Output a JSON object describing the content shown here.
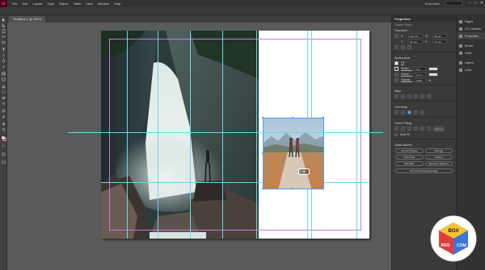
{
  "app": {
    "logo": "Id",
    "menu": [
      "File",
      "Edit",
      "Layout",
      "Type",
      "Object",
      "Table",
      "View",
      "Window",
      "Help"
    ],
    "workspace": "Essentials",
    "window_controls": [
      "–",
      "□",
      "✕"
    ]
  },
  "document": {
    "tab_label": "*Untitled-1 @ 104%"
  },
  "tools": [
    "selection-tool-icon",
    "direct-selection-tool-icon",
    "page-tool-icon",
    "gap-tool-icon",
    "content-collector-icon",
    "type-tool-icon",
    "line-tool-icon",
    "pen-tool-icon",
    "pencil-tool-icon",
    "rectangle-frame-tool-icon",
    "rectangle-tool-icon",
    "scissors-tool-icon",
    "free-transform-tool-icon",
    "gradient-swatch-tool-icon",
    "gradient-feather-tool-icon",
    "note-tool-icon",
    "eyedropper-tool-icon",
    "hand-tool-icon",
    "zoom-tool-icon",
    "fill-stroke-icon",
    "swap-icon",
    "default-colors-icon",
    "screen-mode-icon"
  ],
  "properties_panel": {
    "title": "Properties",
    "subtitle": "Graphic Frame",
    "transform": {
      "title": "Transform",
      "x_label": "X:",
      "x_value": "132 mm",
      "y_label": "Y:",
      "y_value": "46 mm",
      "w_label": "W:",
      "w_value": "66 mm",
      "h_label": "H:",
      "h_value": "76 mm"
    },
    "appearance": {
      "title": "Appearance",
      "fill_label": "Fill",
      "stroke_label": "Stroke",
      "stroke_value": "0 pt",
      "corner_label": "Corner",
      "corner_value": "0 mm",
      "opacity_label": "Opacity",
      "opacity_value": "100%"
    },
    "align": {
      "title": "Align"
    },
    "text_wrap": {
      "title": "Text Wrap"
    },
    "frame_fitting": {
      "title": "Frame Fitting",
      "options_label": "Options",
      "auto_fit_label": "Auto-Fit"
    },
    "quick_actions": {
      "title": "Quick Actions",
      "buttons": [
        "Convert Shape",
        "Arrange",
        "Import File",
        "Embed",
        "Edit With",
        "Reveal in Explorer"
      ],
      "full_button": "Fit Content Proportionally"
    }
  },
  "dock": {
    "items": [
      "Pages",
      "CC Libraries",
      "Properties",
      "Stroke",
      "Color",
      "Layers",
      "Links"
    ],
    "active": "Properties"
  },
  "colors": {
    "accent_frame": "#4a9fff",
    "guide": "#6ad7e6",
    "margin": "#c77ad6",
    "app_logo": "#ff3366"
  }
}
